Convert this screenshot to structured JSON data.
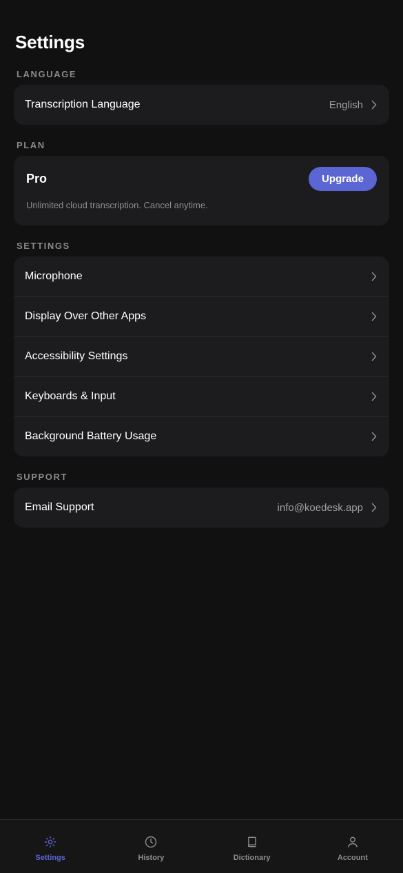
{
  "header": {
    "title": "Settings"
  },
  "sections": {
    "language": {
      "label": "LANGUAGE",
      "rows": [
        {
          "label": "Transcription Language",
          "value": "English"
        }
      ]
    },
    "plan": {
      "label": "PLAN",
      "name": "Pro",
      "upgrade_label": "Upgrade",
      "description": "Unlimited cloud transcription. Cancel anytime."
    },
    "settings": {
      "label": "SETTINGS",
      "rows": [
        {
          "label": "Microphone"
        },
        {
          "label": "Display Over Other Apps"
        },
        {
          "label": "Accessibility Settings"
        },
        {
          "label": "Keyboards & Input"
        },
        {
          "label": "Background Battery Usage"
        }
      ]
    },
    "support": {
      "label": "SUPPORT",
      "rows": [
        {
          "label": "Email Support",
          "value": "info@koedesk.app"
        }
      ]
    }
  },
  "tabbar": {
    "tabs": [
      {
        "label": "Settings",
        "icon": "gear-icon",
        "active": true
      },
      {
        "label": "History",
        "icon": "clock-icon",
        "active": false
      },
      {
        "label": "Dictionary",
        "icon": "book-icon",
        "active": false
      },
      {
        "label": "Account",
        "icon": "person-icon",
        "active": false
      }
    ]
  },
  "colors": {
    "background": "#111111",
    "card": "#1c1c1e",
    "accent": "#5b65d4",
    "muted": "#8e8e93"
  }
}
